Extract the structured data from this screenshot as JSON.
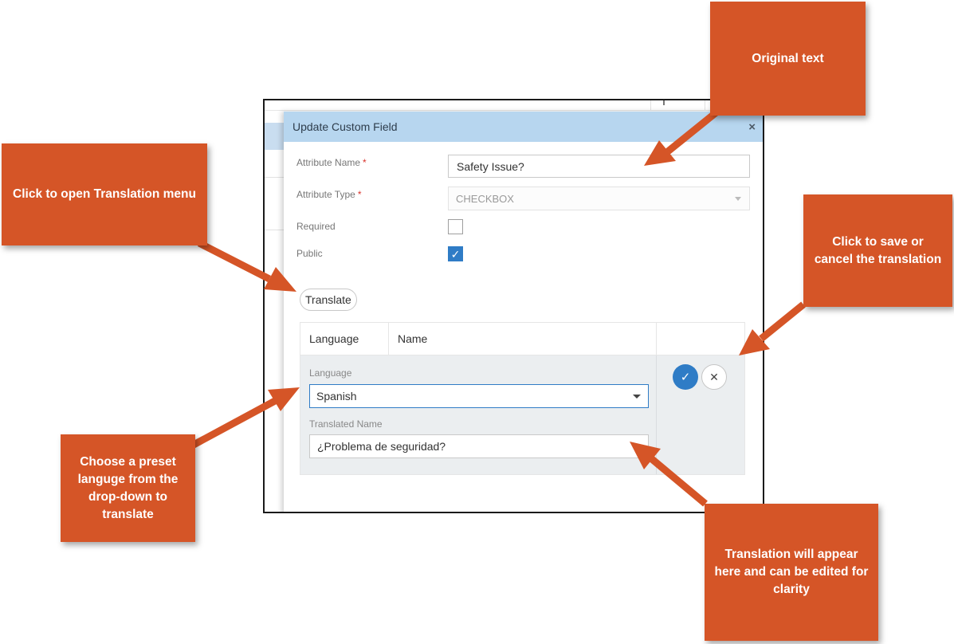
{
  "dialog": {
    "title": "Update Custom Field",
    "close_icon": "×",
    "fields": {
      "attribute_name_label": "Attribute Name",
      "attribute_name_value": "Safety Issue?",
      "attribute_type_label": "Attribute Type",
      "attribute_type_value": "CHECKBOX",
      "required_label": "Required",
      "required_checked": false,
      "public_label": "Public",
      "public_checked": true,
      "required_marker": "*"
    },
    "translate_button": "Translate",
    "translation_table": {
      "headers": [
        "Language",
        "Name"
      ],
      "edit_row": {
        "language_label": "Language",
        "language_value": "Spanish",
        "translated_name_label": "Translated Name",
        "translated_name_value": "¿Problema de seguridad?"
      },
      "save_icon": "✓",
      "cancel_icon": "✕"
    }
  },
  "callouts": {
    "original_text": "Original text",
    "open_translation": "Click to open Translation menu",
    "save_cancel": "Click to save or cancel the translation",
    "choose_language": "Choose a preset languge from the drop-down to translate",
    "translation_appears": "Translation will appear here and can be edited for clarity"
  },
  "colors": {
    "callout": "#d55527",
    "header": "#b7d6ef",
    "accent": "#2f7cc6",
    "required": "#d9332b"
  }
}
